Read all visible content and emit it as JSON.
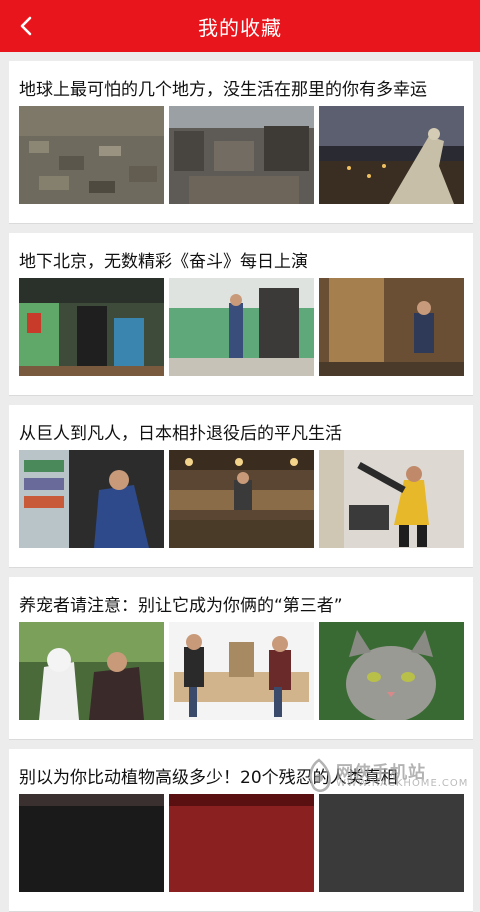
{
  "header": {
    "title": "我的收藏",
    "back_icon": "chevron-left-icon"
  },
  "favorites": [
    {
      "title": "地球上最可怕的几个地方，没生活在那里的你有多幸运"
    },
    {
      "title": "地下北京，无数精彩《奋斗》每日上演"
    },
    {
      "title": "从巨人到凡人，日本相扑退役后的平凡生活"
    },
    {
      "title": "养宠者请注意：别让它成为你俩的“第三者”"
    },
    {
      "title": "别以为你比动植物高级多少！20个残忍的人类真相"
    }
  ],
  "watermark": {
    "name": "网侠手机站",
    "site": "WWW.HACKHOME.COM"
  },
  "colors": {
    "accent": "#e8151c",
    "background": "#ececec"
  }
}
